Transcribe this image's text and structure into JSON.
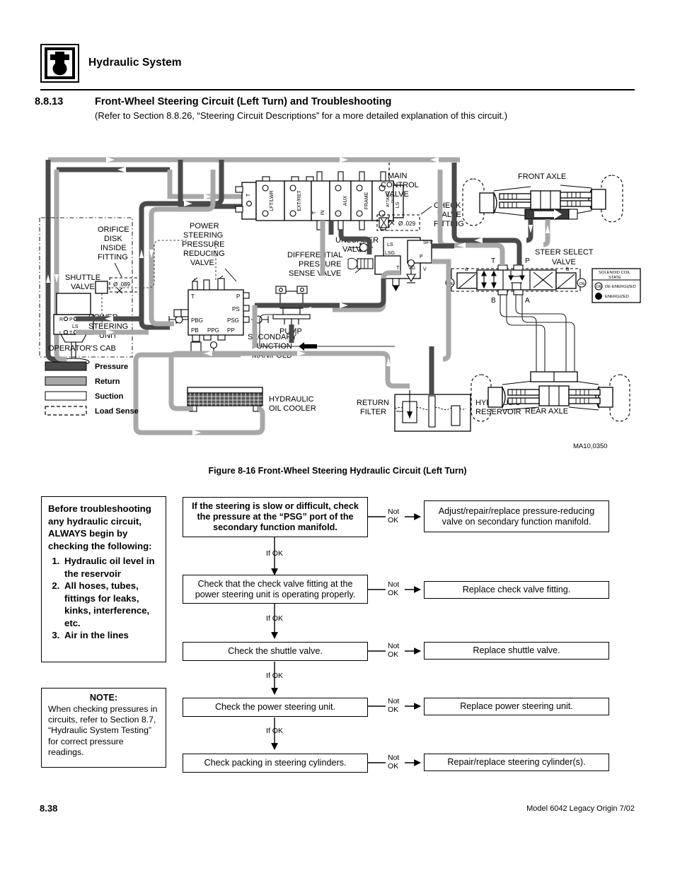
{
  "header": {
    "title": "Hydraulic System",
    "icon": "hydraulic-fluid-icon"
  },
  "section": {
    "number": "8.8.13",
    "title": "Front-Wheel Steering Circuit (Left Turn) and Troubleshooting",
    "subtitle": "(Refer to Section 8.8.26, “Steering Circuit Descriptions” for a more detailed explanation of this circuit.)"
  },
  "figure": {
    "caption": "Figure 8-16  Front-Wheel Steering Hydraulic Circuit (Left Turn)",
    "drawing_id": "MA10,0350",
    "labels": {
      "main_control_valve": [
        "MAIN",
        "CONTROL",
        "VALVE"
      ],
      "check_valve_fitting": [
        "CHECK",
        "VALVE",
        "FITTING"
      ],
      "check_valve_orifice": "Ø .029",
      "orifice_disk": [
        "ORIFICE",
        "DISK",
        "INSIDE",
        "FITTING"
      ],
      "orifice_disk_size": "Ø .089",
      "shuttle_valve": [
        "SHUTTLE",
        "VALVE"
      ],
      "ps_reducing_valve": [
        "POWER",
        "STEERING",
        "PRESSURE",
        "REDUCING",
        "VALVE"
      ],
      "unloader_valve": [
        "UNLOADER",
        "VALVE"
      ],
      "diff_pressure_sense_valve": [
        "DIFFERENTIAL",
        "PRESSURE",
        "SENSE VALVE"
      ],
      "secondary_function_manifold": [
        "SECONDARY",
        "FUNCTION",
        "MANIFOLD"
      ],
      "power_steering_unit": [
        "POWER",
        "STEERING",
        "UNIT"
      ],
      "operators_cab": "OPERATOR'S  CAB",
      "pump": "PUMP",
      "hydraulic_oil_cooler": [
        "HYDRAULIC",
        "OIL  COOLER"
      ],
      "return_filter": [
        "RETURN",
        "FILTER"
      ],
      "hydraulic_reservoir": [
        "HYDRAULIC",
        "RESERVOIR"
      ],
      "front_axle": "FRONT  AXLE",
      "rear_axle": "REAR  AXLE",
      "steer_select_valve": [
        "STEER SELECT",
        "VALVE"
      ]
    },
    "mcv_sections": [
      "T",
      "LFT/LWR",
      "EXT/RET",
      "T",
      "IN",
      "AUX",
      "FRAME",
      "ATTACH TILT",
      "LS"
    ],
    "unloader_ports": [
      "LS",
      "LSG",
      "SFV",
      "P",
      "T",
      "VG",
      "V"
    ],
    "sfm_ports": [
      "T",
      "P",
      "PS",
      "PBG",
      "PSG",
      "PB",
      "PPG",
      "PP"
    ],
    "psu_ports": [
      "R",
      "P",
      "LS",
      "L",
      "T"
    ],
    "steer_select_ports": [
      "T",
      "P",
      "B",
      "A",
      "a",
      "b"
    ],
    "solenoid_legend": {
      "title": [
        "SOLENOID COIL",
        "STATE"
      ],
      "items": [
        {
          "symbol": "DE",
          "label": "DE-ENERGIZED"
        },
        {
          "symbol": "E",
          "label": "ENERGIZED"
        }
      ]
    },
    "legend": [
      {
        "label": "Pressure",
        "style": "solid-dark",
        "color": "#4a4a4a"
      },
      {
        "label": "Return",
        "style": "solid-mid",
        "color": "#a0a0a0"
      },
      {
        "label": "Suction",
        "style": "outline",
        "color": "#ffffff"
      },
      {
        "label": "Load Sense",
        "style": "dashed",
        "color": "#ffffff"
      }
    ]
  },
  "pre_check": {
    "intro": "Before troubleshooting any hydraulic circuit, ALWAYS begin by checking the following:",
    "items": [
      "Hydraulic oil level in the reservoir",
      "All hoses, tubes, fittings for leaks, kinks, interference, etc.",
      "Air in the lines"
    ]
  },
  "note": {
    "title": "NOTE:",
    "text": "When checking pressures in circuits, refer to Section 8.7, “Hydraulic System Testing” for correct pressure readings."
  },
  "flowchart": {
    "if_ok_label": "If OK",
    "not_ok_label_line1": "Not",
    "not_ok_label_line2": "OK",
    "steps": [
      {
        "check": "If the steering is slow or difficult, check the pressure at the “PSG” port of the secondary function manifold.",
        "action": "Adjust/repair/replace pressure-reducing valve on secondary function manifold."
      },
      {
        "check": "Check that the check valve fitting at the power steering unit is operating properly.",
        "action": "Replace check valve fitting."
      },
      {
        "check": "Check the shuttle valve.",
        "action": "Replace shuttle valve."
      },
      {
        "check": "Check the power steering unit.",
        "action": "Replace power steering unit."
      },
      {
        "check": "Check packing in steering cylinders.",
        "action": "Repair/replace steering cylinder(s)."
      }
    ]
  },
  "footer": {
    "page": "8.38",
    "model": "Model  6042  Legacy    Origin  7/02"
  }
}
